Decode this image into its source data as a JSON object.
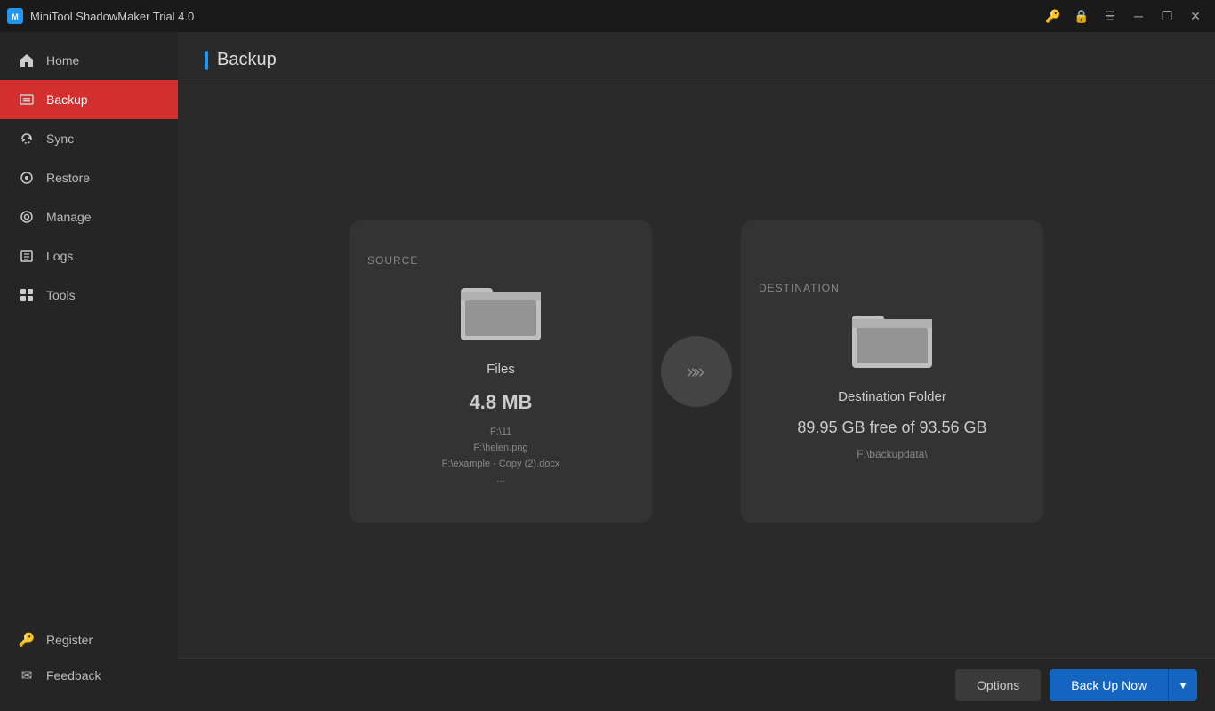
{
  "titlebar": {
    "logo_letter": "M",
    "title": "MiniTool ShadowMaker Trial 4.0",
    "icons": {
      "key": "🔑",
      "lock": "🔒",
      "menu": "☰",
      "minimize": "─",
      "restore": "❐",
      "close": "✕"
    }
  },
  "sidebar": {
    "items": [
      {
        "id": "home",
        "label": "Home",
        "icon": "🏠",
        "active": false
      },
      {
        "id": "backup",
        "label": "Backup",
        "icon": "⊞",
        "active": true
      },
      {
        "id": "sync",
        "label": "Sync",
        "icon": "⊟",
        "active": false
      },
      {
        "id": "restore",
        "label": "Restore",
        "icon": "⊙",
        "active": false
      },
      {
        "id": "manage",
        "label": "Manage",
        "icon": "⊚",
        "active": false
      },
      {
        "id": "logs",
        "label": "Logs",
        "icon": "≡",
        "active": false
      },
      {
        "id": "tools",
        "label": "Tools",
        "icon": "⊞",
        "active": false
      }
    ],
    "bottom_items": [
      {
        "id": "register",
        "label": "Register",
        "icon": "🔑"
      },
      {
        "id": "feedback",
        "label": "Feedback",
        "icon": "✉"
      }
    ]
  },
  "page": {
    "title": "Backup"
  },
  "source_card": {
    "label": "SOURCE",
    "type": "Files",
    "size": "4.8 MB",
    "files": "F:\\11\nF:\\helen.png\nF:\\example - Copy (2).docx\n..."
  },
  "destination_card": {
    "label": "DESTINATION",
    "type": "Destination Folder",
    "free": "89.95 GB free of 93.56 GB",
    "path": "F:\\backupdata\\"
  },
  "footer": {
    "options_label": "Options",
    "backup_now_label": "Back Up Now",
    "dropdown_arrow": "▼"
  },
  "colors": {
    "accent_blue": "#2196F3",
    "active_red": "#d32f2f",
    "backup_btn": "#1565C0"
  }
}
